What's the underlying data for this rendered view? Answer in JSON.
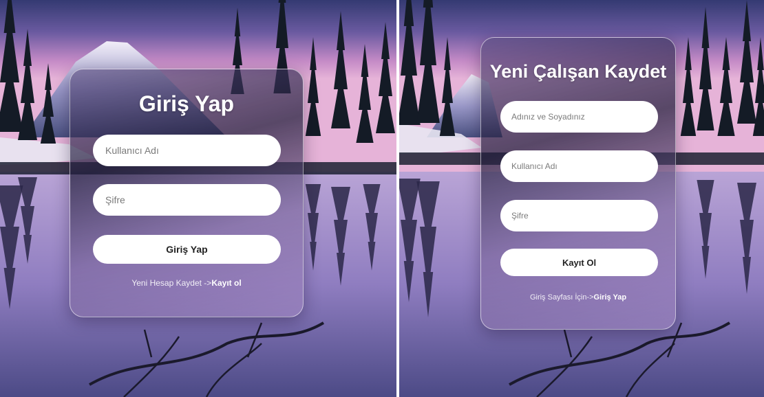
{
  "login": {
    "title": "Giriş Yap",
    "username_placeholder": "Kullanıcı Adı",
    "password_placeholder": "Şifre",
    "submit_label": "Giriş Yap",
    "footer_text": "Yeni Hesap Kaydet ->",
    "footer_link": "Kayıt ol"
  },
  "register": {
    "title": "Yeni Çalışan Kaydet",
    "fullname_placeholder": "Adınız ve Soyadınız",
    "username_placeholder": "Kullanıcı Adı",
    "password_placeholder": "Şifre",
    "submit_label": "Kayıt Ol",
    "footer_text": "Giriş Sayfası İçin->",
    "footer_link": "Giriş Yap"
  },
  "colors": {
    "sky_top": "#3a3f78",
    "sky_mid": "#b57fc0",
    "lake": "#9a86c4",
    "card_border": "#ffffff",
    "button_bg": "#ffffff"
  }
}
